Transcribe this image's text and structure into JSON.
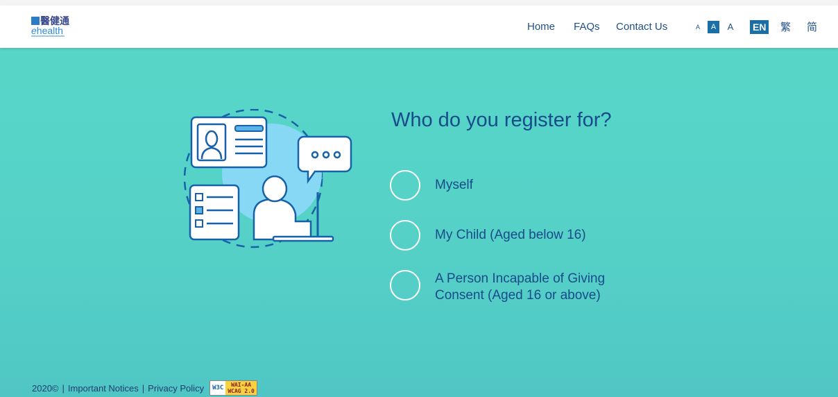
{
  "header": {
    "logo": {
      "cn": "醫健通",
      "en": "health",
      "en_prefix": "e"
    },
    "nav": {
      "home": "Home",
      "faqs": "FAQs",
      "contact": "Contact Us"
    },
    "font_size": {
      "small": "A",
      "medium": "A",
      "large": "A",
      "selected": "medium"
    },
    "languages": {
      "en": "EN",
      "tc": "繁",
      "sc": "简",
      "selected": "en"
    }
  },
  "main": {
    "question": "Who do you register for?",
    "options": [
      {
        "label": "Myself"
      },
      {
        "label": "My Child (Aged below 16)"
      },
      {
        "label": "A Person Incapable of Giving Consent (Aged 16 or above)"
      }
    ]
  },
  "footer": {
    "year": "2020©",
    "sep1": "|",
    "important_notices": "Important Notices",
    "sep2": "|",
    "privacy_policy": "Privacy Policy",
    "badge_w3c": "W3C",
    "badge_wai": "WAI-AA",
    "badge_wcag": "WCAG 2.0"
  },
  "colors": {
    "accent": "#1a6fa6",
    "text_dark_blue": "#174b8a",
    "background_teal": "#57d7c8"
  }
}
